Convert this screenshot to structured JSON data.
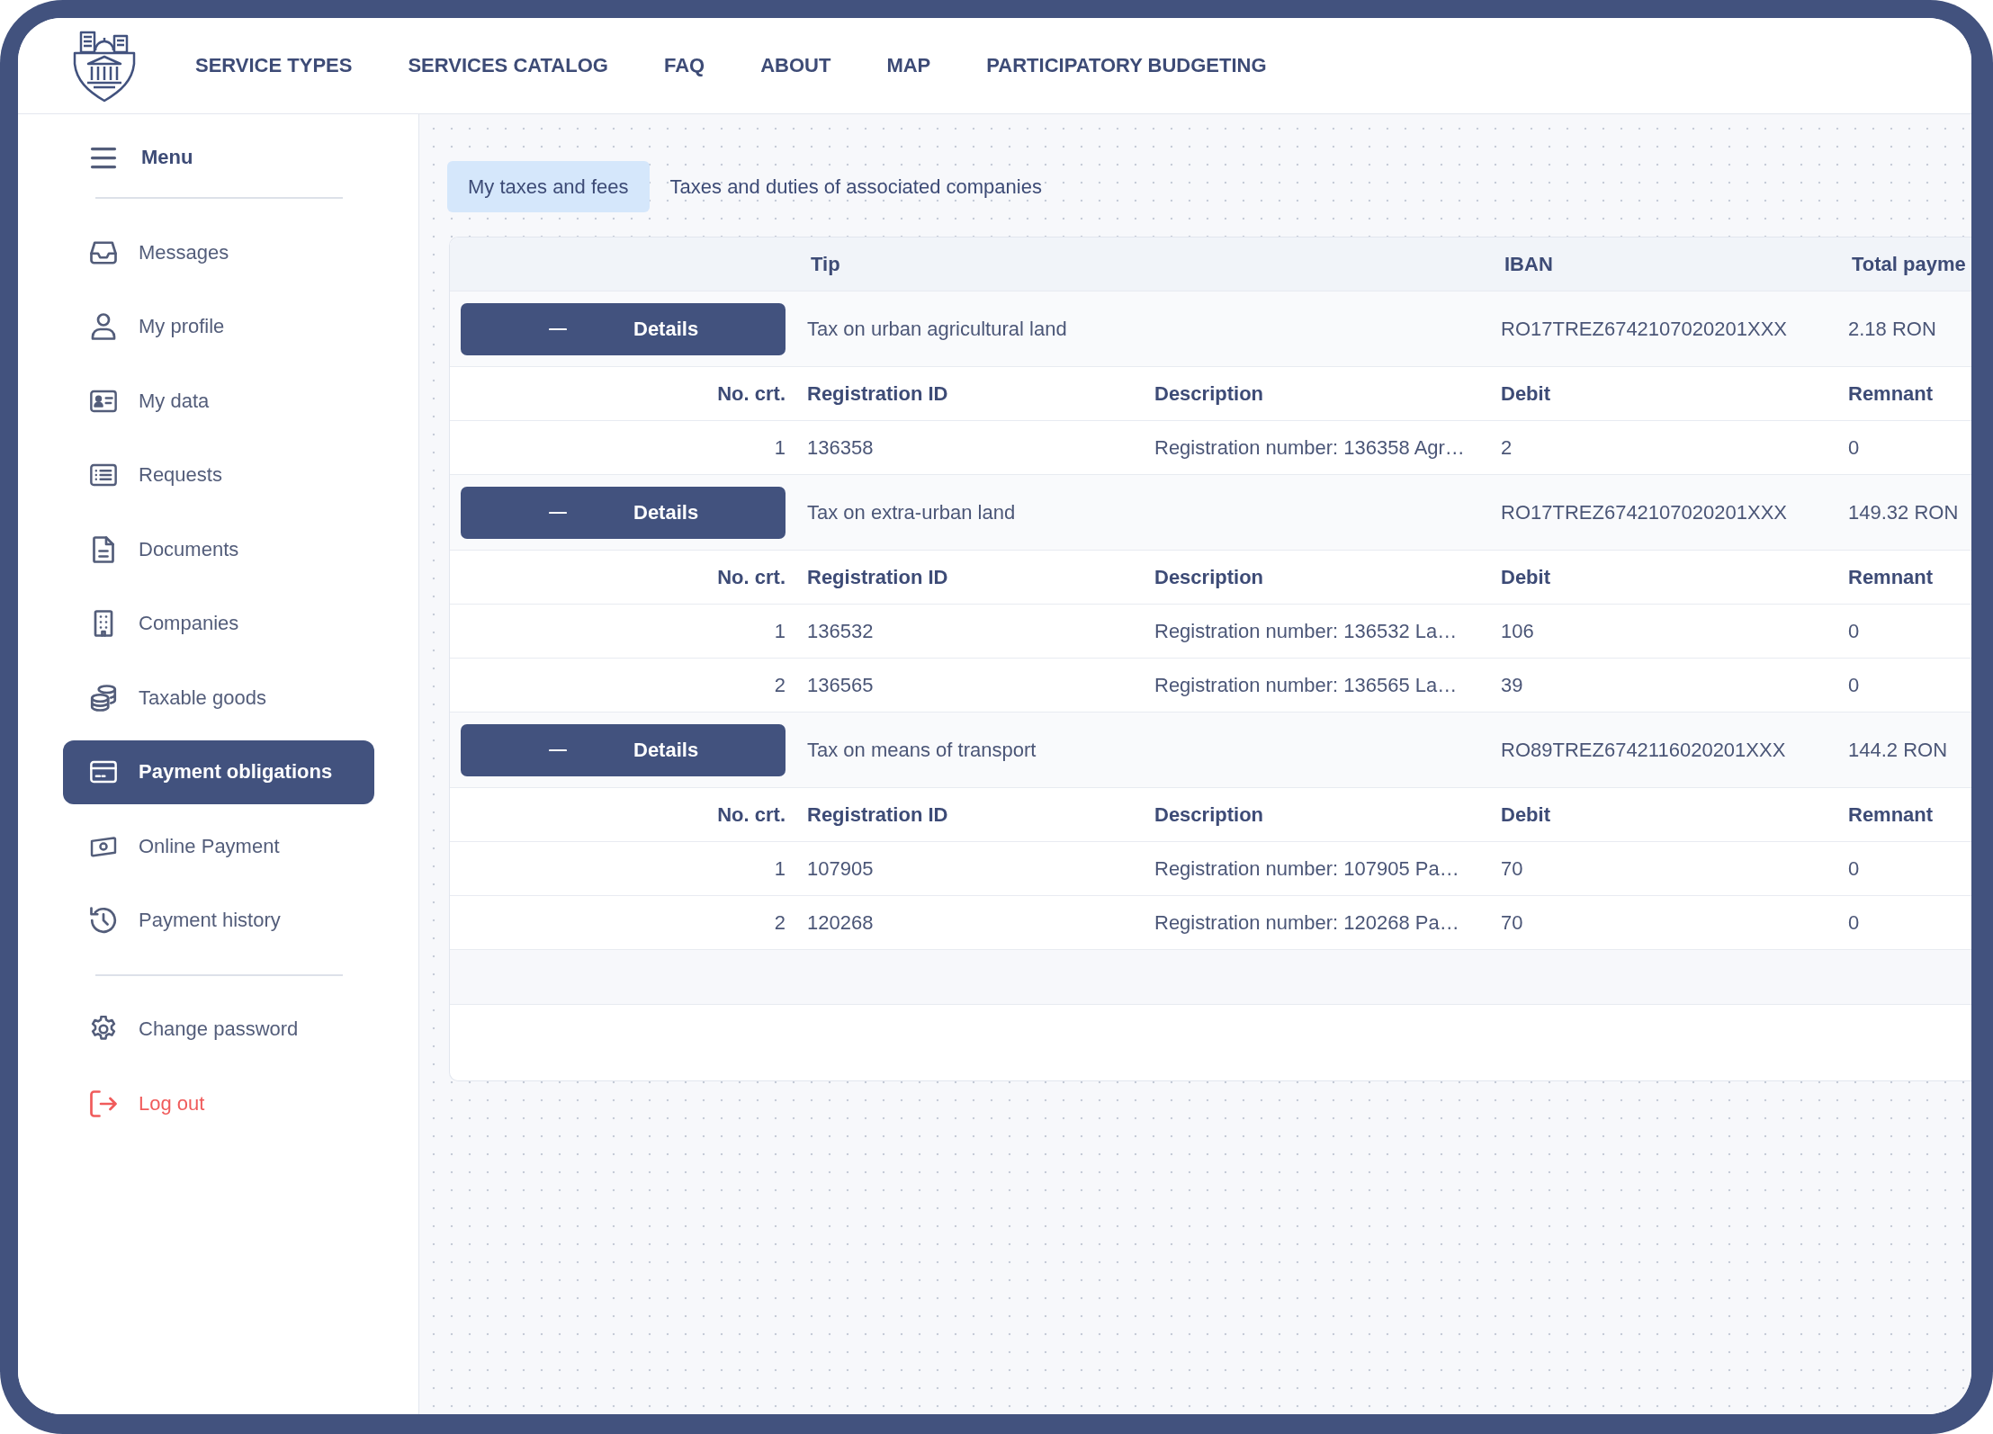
{
  "header": {
    "nav": [
      "SERVICE TYPES",
      "SERVICES CATALOG",
      "FAQ",
      "ABOUT",
      "MAP",
      "PARTICIPATORY BUDGETING"
    ]
  },
  "sidebar": {
    "title": "Menu",
    "sections": [
      {
        "items": [
          {
            "label": "Messages",
            "kind": "link",
            "selected": false
          },
          {
            "label": "My profile",
            "kind": "link",
            "selected": false
          },
          {
            "label": "My data",
            "kind": "link",
            "selected": false
          },
          {
            "label": "Requests",
            "kind": "link",
            "selected": false
          },
          {
            "label": "Documents",
            "kind": "link",
            "selected": false
          },
          {
            "label": "Companies",
            "kind": "link",
            "selected": false
          },
          {
            "label": "Taxable goods",
            "kind": "link",
            "selected": false
          },
          {
            "label": "Payment obligations",
            "kind": "link",
            "selected": true
          },
          {
            "label": "Online Payment",
            "kind": "link",
            "selected": false
          },
          {
            "label": "Payment history",
            "kind": "link",
            "selected": false
          }
        ]
      },
      {
        "items": [
          {
            "label": "Change password",
            "kind": "link",
            "selected": false
          },
          {
            "label": "Log out",
            "kind": "danger",
            "selected": false
          }
        ]
      }
    ]
  },
  "tabs": [
    {
      "label": "My taxes and fees",
      "selected": true
    },
    {
      "label": "Taxes and duties of associated companies",
      "selected": false
    }
  ],
  "table": {
    "columns": [
      "Tip",
      "IBAN",
      "Total payme"
    ],
    "groups": [
      {
        "button": "Details",
        "expanded": true,
        "tip": "Tax on urban agricultural land",
        "iban": "RO17TREZ6742107020201XXX",
        "total": "2.18 RON",
        "detail_columns": [
          "No. crt.",
          "Registration ID",
          "Description",
          "Debit",
          "Remnant"
        ],
        "rows": [
          {
            "no": "1",
            "registration_id": "136358",
            "description": "Registration number: 136358 Agr…",
            "debit": "2",
            "remnant": "0"
          }
        ]
      },
      {
        "button": "Details",
        "expanded": true,
        "tip": "Tax on extra-urban land",
        "iban": "RO17TREZ6742107020201XXX",
        "total": "149.32 RON",
        "detail_columns": [
          "No. crt.",
          "Registration ID",
          "Description",
          "Debit",
          "Remnant"
        ],
        "rows": [
          {
            "no": "1",
            "registration_id": "136532",
            "description": "Registration number: 136532 La…",
            "debit": "106",
            "remnant": "0"
          },
          {
            "no": "2",
            "registration_id": "136565",
            "description": "Registration number: 136565 La…",
            "debit": "39",
            "remnant": "0"
          }
        ]
      },
      {
        "button": "Details",
        "expanded": true,
        "tip": "Tax on means of transport",
        "iban": "RO89TREZ6742116020201XXX",
        "total": "144.2 RON",
        "detail_columns": [
          "No. crt.",
          "Registration ID",
          "Description",
          "Debit",
          "Remnant"
        ],
        "rows": [
          {
            "no": "1",
            "registration_id": "107905",
            "description": "Registration number: 107905 Pa…",
            "debit": "70",
            "remnant": "0"
          },
          {
            "no": "2",
            "registration_id": "120268",
            "description": "Registration number: 120268 Pa…",
            "debit": "70",
            "remnant": "0"
          }
        ]
      }
    ]
  }
}
